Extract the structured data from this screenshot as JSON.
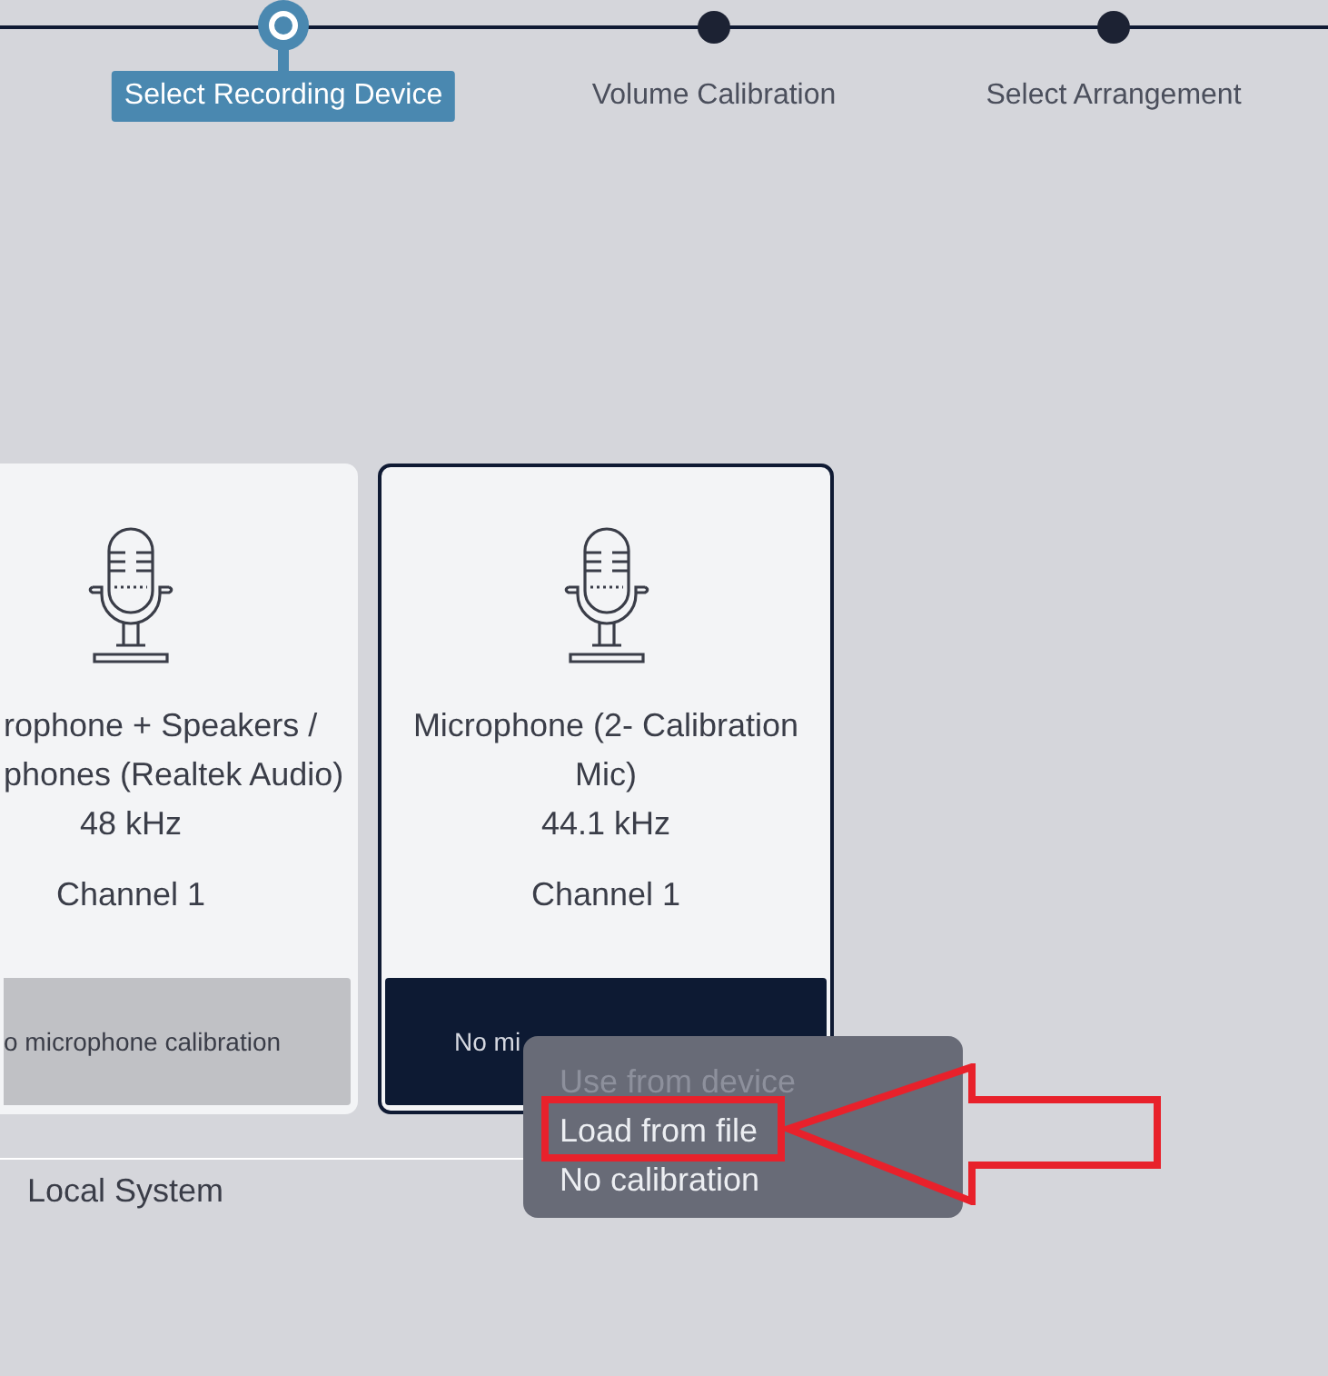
{
  "steps": [
    {
      "label": "Select Recording Device",
      "selected": true
    },
    {
      "label": "Volume Calibration",
      "selected": false
    },
    {
      "label": "Select Arrangement",
      "selected": false
    }
  ],
  "devices": [
    {
      "name_lines": [
        "rophone + Speakers /",
        "phones (Realtek Audio)"
      ],
      "rate": "48 kHz",
      "channel": "Channel 1",
      "calibration": "o microphone calibration",
      "selected": false,
      "cut_left": true
    },
    {
      "name_lines": [
        "Microphone (2- Calibration",
        "Mic)"
      ],
      "rate": "44.1 kHz",
      "channel": "Channel 1",
      "calibration": "No mi",
      "selected": true,
      "cut_left": false
    }
  ],
  "group_label": "Local System",
  "menu": [
    {
      "label": "Use from device",
      "disabled": true
    },
    {
      "label": "Load from file",
      "disabled": false
    },
    {
      "label": "No calibration",
      "disabled": false
    }
  ]
}
